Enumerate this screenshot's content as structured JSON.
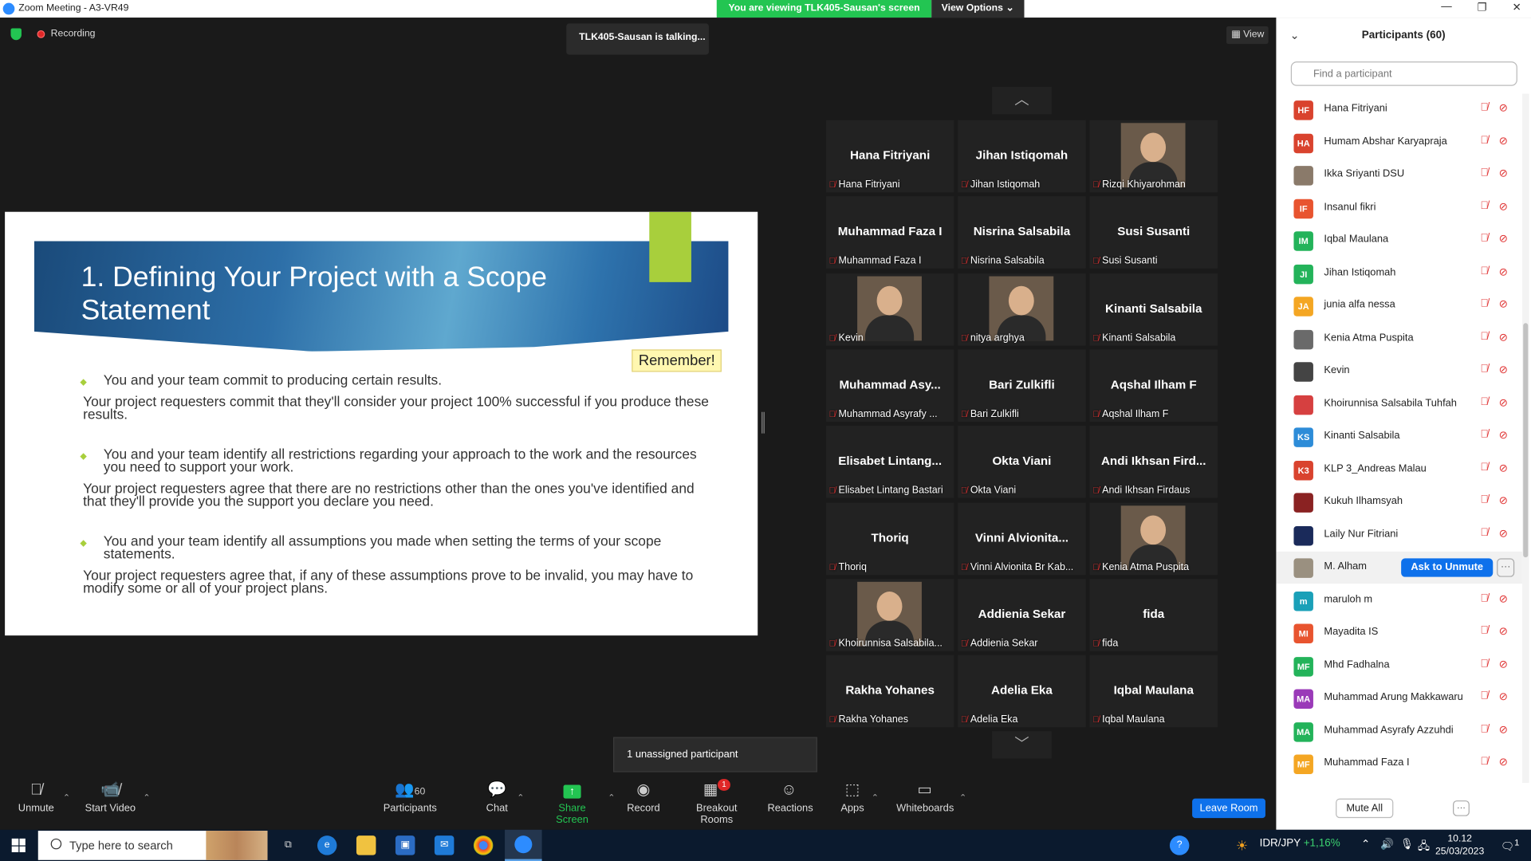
{
  "window": {
    "title": "Zoom Meeting - A3-VR49",
    "controls": [
      "—",
      "❐",
      "✕"
    ]
  },
  "banner": {
    "viewing": "You are viewing TLK405-Sausan's screen",
    "options": "View Options"
  },
  "recording": "Recording",
  "talking": "TLK405-Sausan is talking...",
  "view_btn": "View",
  "slide": {
    "title": "1. Defining Your Project with a Scope Statement",
    "remember": "Remember!",
    "bullets": [
      {
        "main": "You and your team commit to producing certain results.",
        "sub": "Your project requesters commit that they'll consider your project 100% successful if you produce these results."
      },
      {
        "main": "You and your team identify all restrictions regarding your approach to the work and the resources you need to support your work.",
        "sub": "Your project requesters agree that there are no restrictions other than the ones you've identified and that they'll provide you the support you declare you need."
      },
      {
        "main": "You and your team identify all assumptions you made when setting the terms of your scope statements.",
        "sub": "Your project requesters agree that, if any of these assumptions prove to be invalid, you may have to modify some or all of your project plans."
      }
    ]
  },
  "gallery": [
    {
      "big": "Hana Fitriyani",
      "name": "Hana Fitriyani",
      "photo": false
    },
    {
      "big": "Jihan Istiqomah",
      "name": "Jihan Istiqomah",
      "photo": false
    },
    {
      "big": "",
      "name": "Rizqi Khiyarohman",
      "photo": true
    },
    {
      "big": "Muhammad Faza I",
      "name": "Muhammad Faza I",
      "photo": false
    },
    {
      "big": "Nisrina Salsabila",
      "name": "Nisrina Salsabila",
      "photo": false
    },
    {
      "big": "Susi Susanti",
      "name": "Susi Susanti",
      "photo": false
    },
    {
      "big": "",
      "name": "Kevin",
      "photo": true
    },
    {
      "big": "",
      "name": "nitya arghya",
      "photo": true
    },
    {
      "big": "Kinanti Salsabila",
      "name": "Kinanti Salsabila",
      "photo": false
    },
    {
      "big": "Muhammad  Asy...",
      "name": "Muhammad Asyrafy ...",
      "photo": false
    },
    {
      "big": "Bari Zulkifli",
      "name": "Bari Zulkifli",
      "photo": false
    },
    {
      "big": "Aqshal Ilham F",
      "name": "Aqshal Ilham F",
      "photo": false
    },
    {
      "big": "Elisabet  Lintang...",
      "name": "Elisabet Lintang Bastari",
      "photo": false
    },
    {
      "big": "Okta Viani",
      "name": "Okta Viani",
      "photo": false
    },
    {
      "big": "Andi  Ikhsan  Fird...",
      "name": "Andi Ikhsan Firdaus",
      "photo": false
    },
    {
      "big": "Thoriq",
      "name": "Thoriq",
      "photo": false
    },
    {
      "big": "Vinni  Alvionita...",
      "name": "Vinni Alvionita Br Kab...",
      "photo": false
    },
    {
      "big": "",
      "name": "Kenia Atma Puspita",
      "photo": true
    },
    {
      "big": "",
      "name": "Khoirunnisa Salsabila...",
      "photo": true
    },
    {
      "big": "Addienia Sekar",
      "name": "Addienia Sekar",
      "photo": false
    },
    {
      "big": "fida",
      "name": "fida",
      "photo": false
    },
    {
      "big": "Rakha Yohanes",
      "name": "Rakha Yohanes",
      "photo": false
    },
    {
      "big": "Adelia Eka",
      "name": "Adelia Eka",
      "photo": false
    },
    {
      "big": "Iqbal Maulana",
      "name": "Iqbal Maulana",
      "photo": false
    }
  ],
  "unassigned": "1 unassigned participant",
  "toolbar": {
    "unmute": "Unmute",
    "start_video": "Start Video",
    "participants": "Participants",
    "participants_count": "60",
    "chat": "Chat",
    "share": "Share Screen",
    "record": "Record",
    "breakout": "Breakout Rooms",
    "breakout_badge": "1",
    "reactions": "Reactions",
    "apps": "Apps",
    "whiteboards": "Whiteboards",
    "leave": "Leave Room"
  },
  "panel": {
    "title": "Participants (60)",
    "search_placeholder": "Find a participant",
    "mute_all": "Mute All",
    "more": "···",
    "ask_unmute": "Ask to Unmute",
    "participants": [
      {
        "initials": "HF",
        "name": "Hana Fitriyani",
        "color": "#d9432e"
      },
      {
        "initials": "HA",
        "name": "Humam Abshar Karyapraja",
        "color": "#d9432e"
      },
      {
        "initials": "",
        "name": "Ikka Sriyanti DSU",
        "color": "#8a7a6a"
      },
      {
        "initials": "IF",
        "name": "Insanul fikri",
        "color": "#e8542f"
      },
      {
        "initials": "IM",
        "name": "Iqbal Maulana",
        "color": "#23b35a"
      },
      {
        "initials": "JI",
        "name": "Jihan Istiqomah",
        "color": "#23b35a"
      },
      {
        "initials": "JA",
        "name": "junia alfa nessa",
        "color": "#f4a623"
      },
      {
        "initials": "",
        "name": "Kenia Atma Puspita",
        "color": "#6a6a6a"
      },
      {
        "initials": "",
        "name": "Kevin",
        "color": "#444444"
      },
      {
        "initials": "",
        "name": "Khoirunnisa Salsabila Tuhfah",
        "color": "#d64040"
      },
      {
        "initials": "KS",
        "name": "Kinanti Salsabila",
        "color": "#2d8cd8"
      },
      {
        "initials": "K3",
        "name": "KLP 3_Andreas Malau",
        "color": "#d9432e"
      },
      {
        "initials": "",
        "name": "Kukuh Ilhamsyah",
        "color": "#8a2222"
      },
      {
        "initials": "",
        "name": "Laily Nur Fitriani",
        "color": "#1a2a5a"
      },
      {
        "initials": "",
        "name": "M. Alham",
        "color": "#9a9080"
      },
      {
        "initials": "m",
        "name": "maruloh m",
        "color": "#1aa0b8"
      },
      {
        "initials": "MI",
        "name": "Mayadita IS",
        "color": "#e8542f"
      },
      {
        "initials": "MF",
        "name": "Mhd Fadhalna",
        "color": "#23b35a"
      },
      {
        "initials": "MA",
        "name": "Muhammad Arung Makkawaru",
        "color": "#9a3ab8"
      },
      {
        "initials": "MA",
        "name": "Muhammad Asyrafy Azzuhdi",
        "color": "#23b35a"
      },
      {
        "initials": "MF",
        "name": "Muhammad Faza I",
        "color": "#f4a623"
      }
    ]
  },
  "taskbar": {
    "search": "Type here to search",
    "ticker_pair": "IDR/JPY",
    "ticker_change": "+1,16%",
    "time": "10.12",
    "date": "25/03/2023",
    "notif": "1"
  }
}
